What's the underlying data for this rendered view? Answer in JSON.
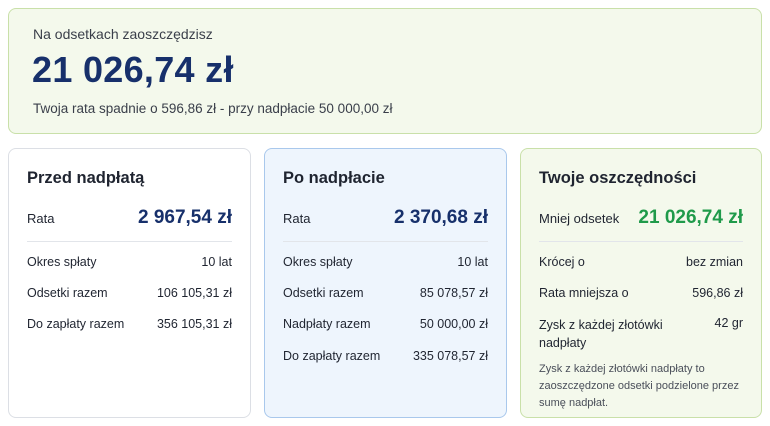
{
  "summary": {
    "label": "Na odsetkach zaoszczędzisz",
    "amount": "21 026,74 zł",
    "subtitle": "Twoja rata spadnie o 596,86 zł - przy nadpłacie 50 000,00 zł"
  },
  "before": {
    "title": "Przed nadpłatą",
    "main_label": "Rata",
    "main_value": "2 967,54 zł",
    "rows": [
      {
        "label": "Okres spłaty",
        "value": "10 lat"
      },
      {
        "label": "Odsetki razem",
        "value": "106 105,31 zł"
      },
      {
        "label": "Do zapłaty razem",
        "value": "356 105,31 zł"
      }
    ]
  },
  "after": {
    "title": "Po nadpłacie",
    "main_label": "Rata",
    "main_value": "2 370,68 zł",
    "rows": [
      {
        "label": "Okres spłaty",
        "value": "10 lat"
      },
      {
        "label": "Odsetki razem",
        "value": "85 078,57 zł"
      },
      {
        "label": "Nadpłaty razem",
        "value": "50 000,00 zł"
      },
      {
        "label": "Do zapłaty razem",
        "value": "335 078,57 zł"
      }
    ]
  },
  "savings": {
    "title": "Twoje oszczędności",
    "main_label": "Mniej odsetek",
    "main_value": "21 026,74 zł",
    "rows": [
      {
        "label": "Krócej o",
        "value": "bez zmian"
      },
      {
        "label": "Rata mniejsza o",
        "value": "596,86 zł"
      },
      {
        "label": "Zysk z każdej złotówki nadpłaty",
        "value": "42 gr"
      }
    ],
    "note": "Zysk z każdej złotówki nadpłaty to zaoszczędzone odsetki podzielone przez sumę nadpłat."
  },
  "colors": {
    "primary_navy": "#17306b",
    "savings_green": "#1f9a4a",
    "green_panel_bg": "#f4f9ec",
    "blue_panel_bg": "#eef5fd"
  }
}
